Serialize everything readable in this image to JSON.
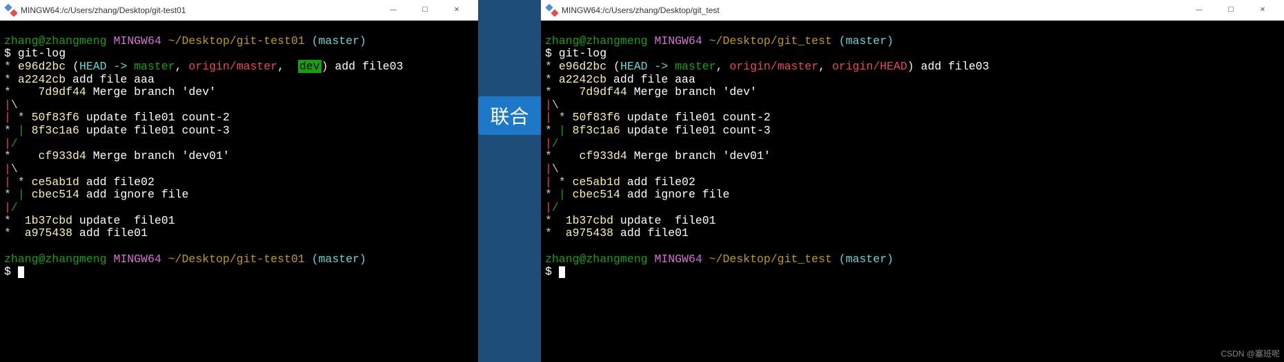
{
  "left": {
    "title": "MINGW64:/c/Users/zhang/Desktop/git-test01",
    "prompt": {
      "user": "zhang@zhangmeng",
      "env": "MINGW64",
      "path": "~/Desktop/git-test01",
      "branch": "(master)"
    },
    "command": "git-log",
    "log": [
      {
        "graph": "*",
        "hash": "e96d2bc",
        "refs_open": "(",
        "head": "HEAD -> ",
        "master": "master",
        "sep1": ", ",
        "origin_master": "origin/master",
        "sep2": ", ",
        "dev_hl": "dev",
        "refs_close": ")",
        "msg": " add file03"
      },
      {
        "graph": "*",
        "hash": "a2242cb",
        "msg": " add file aaa"
      },
      {
        "graph": "*  ",
        "hash": " 7d9df44",
        "msg": " Merge branch 'dev'"
      },
      {
        "graph_colored": [
          {
            "t": "|",
            "c": "red"
          },
          {
            "t": "\\",
            "c": "white"
          }
        ]
      },
      {
        "graph_colored": [
          {
            "t": "|",
            "c": "red"
          },
          {
            "t": " * ",
            "c": "white"
          }
        ],
        "hash": "50f83f6",
        "msg": " update file01 count-2"
      },
      {
        "graph_colored": [
          {
            "t": "* ",
            "c": "white"
          },
          {
            "t": "| ",
            "c": "green"
          }
        ],
        "hash": "8f3c1a6",
        "msg": " update file01 count-3"
      },
      {
        "graph_colored": [
          {
            "t": "|",
            "c": "red"
          },
          {
            "t": "/",
            "c": "green"
          }
        ]
      },
      {
        "graph": "*   ",
        "hash": "cf933d4",
        "msg": " Merge branch 'dev01'"
      },
      {
        "graph_colored": [
          {
            "t": "|",
            "c": "red"
          },
          {
            "t": "\\",
            "c": "white"
          }
        ]
      },
      {
        "graph_colored": [
          {
            "t": "|",
            "c": "red"
          },
          {
            "t": " * ",
            "c": "white"
          }
        ],
        "hash": "ce5ab1d",
        "msg": " add file02"
      },
      {
        "graph_colored": [
          {
            "t": "* ",
            "c": "white"
          },
          {
            "t": "| ",
            "c": "green"
          }
        ],
        "hash": "cbec514",
        "msg": " add ignore file"
      },
      {
        "graph_colored": [
          {
            "t": "|",
            "c": "red"
          },
          {
            "t": "/",
            "c": "green"
          }
        ]
      },
      {
        "graph": "*",
        "hash": " 1b37cbd",
        "msg": " update  file01"
      },
      {
        "graph": "*",
        "hash": " a975438",
        "msg": " add file01"
      }
    ],
    "dollar": "$"
  },
  "right": {
    "title": "MINGW64:/c/Users/zhang/Desktop/git_test",
    "prompt": {
      "user": "zhang@zhangmeng",
      "env": "MINGW64",
      "path": "~/Desktop/git_test",
      "branch": "(master)"
    },
    "command": "git-log",
    "log": [
      {
        "graph": "*",
        "hash": "e96d2bc",
        "refs_open": "(",
        "head": "HEAD -> ",
        "master": "master",
        "sep1": ", ",
        "origin_master": "origin/master",
        "sep2": ", ",
        "origin_head": "origin/HEAD",
        "refs_close": ")",
        "msg": " add file03"
      },
      {
        "graph": "*",
        "hash": "a2242cb",
        "msg": " add file aaa"
      },
      {
        "graph": "*  ",
        "hash": " 7d9df44",
        "msg": " Merge branch 'dev'"
      },
      {
        "graph_colored": [
          {
            "t": "|",
            "c": "red"
          },
          {
            "t": "\\",
            "c": "white"
          }
        ]
      },
      {
        "graph_colored": [
          {
            "t": "|",
            "c": "red"
          },
          {
            "t": " * ",
            "c": "white"
          }
        ],
        "hash": "50f83f6",
        "msg": " update file01 count-2"
      },
      {
        "graph_colored": [
          {
            "t": "* ",
            "c": "white"
          },
          {
            "t": "| ",
            "c": "green"
          }
        ],
        "hash": "8f3c1a6",
        "msg": " update file01 count-3"
      },
      {
        "graph_colored": [
          {
            "t": "|",
            "c": "red"
          },
          {
            "t": "/",
            "c": "green"
          }
        ]
      },
      {
        "graph": "*   ",
        "hash": "cf933d4",
        "msg": " Merge branch 'dev01'"
      },
      {
        "graph_colored": [
          {
            "t": "|",
            "c": "red"
          },
          {
            "t": "\\",
            "c": "white"
          }
        ]
      },
      {
        "graph_colored": [
          {
            "t": "|",
            "c": "red"
          },
          {
            "t": " * ",
            "c": "white"
          }
        ],
        "hash": "ce5ab1d",
        "msg": " add file02"
      },
      {
        "graph_colored": [
          {
            "t": "* ",
            "c": "white"
          },
          {
            "t": "| ",
            "c": "green"
          }
        ],
        "hash": "cbec514",
        "msg": " add ignore file"
      },
      {
        "graph_colored": [
          {
            "t": "|",
            "c": "red"
          },
          {
            "t": "/",
            "c": "green"
          }
        ]
      },
      {
        "graph": "*",
        "hash": " 1b37cbd",
        "msg": " update  file01"
      },
      {
        "graph": "*",
        "hash": " a975438",
        "msg": " add file01"
      }
    ],
    "dollar": "$"
  },
  "badge": "联合",
  "watermark": "CSDN @塞班呢",
  "win_controls": {
    "min": "—",
    "max": "☐",
    "close": "✕"
  }
}
